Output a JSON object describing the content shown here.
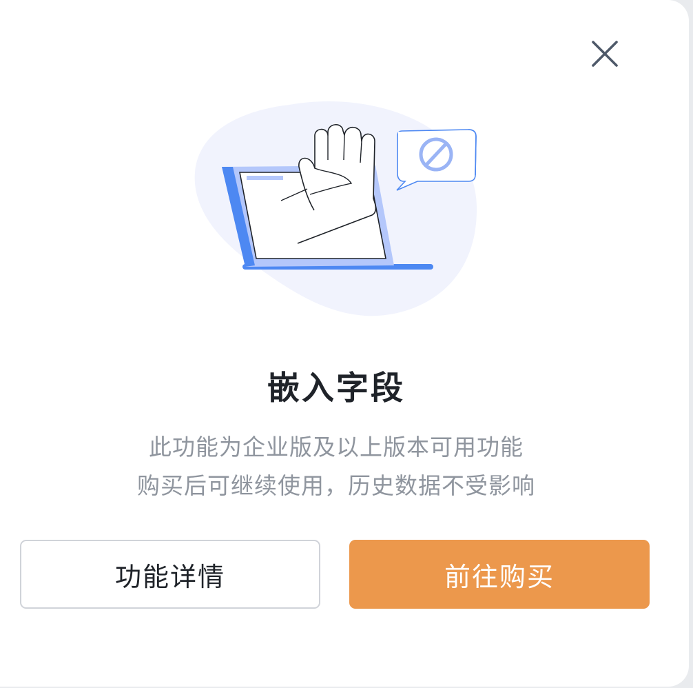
{
  "dialog": {
    "close_icon": "close-icon",
    "illustration_icon": "laptop-hand-blocked-illustration",
    "title": "嵌入字段",
    "description_line1": "此功能为企业版及以上版本可用功能",
    "description_line2": "购买后可继续使用，历史数据不受影响",
    "details_button_label": "功能详情",
    "purchase_button_label": "前往购买"
  },
  "colors": {
    "primary_button": "#ec984c",
    "illustration_blue": "#4d88f2",
    "illustration_light_blue": "#b4c7fb",
    "illustration_bg": "#f1f3fd"
  }
}
